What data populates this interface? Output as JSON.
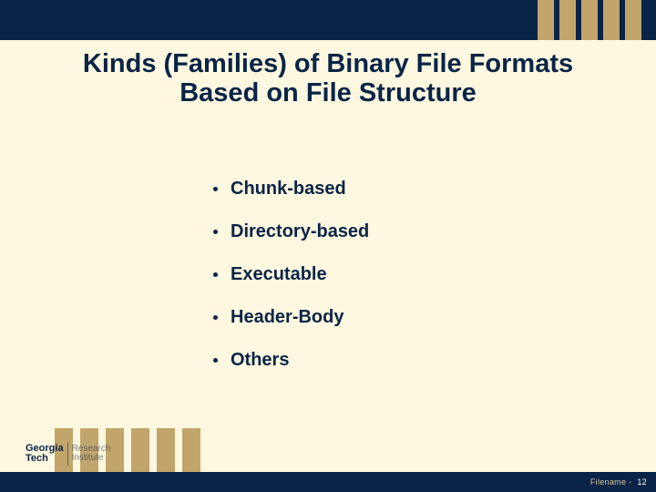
{
  "title_line1": "Kinds (Families) of Binary File Formats",
  "title_line2": "Based on File Structure",
  "bullets": {
    "b0": "Chunk-based",
    "b1": "Directory-based",
    "b2": "Executable",
    "b3": "Header-Body",
    "b4": "Others"
  },
  "logo": {
    "line1": "Georgia",
    "line2": "Tech",
    "ri1": "Research",
    "ri2": "Institute"
  },
  "footer": {
    "label": "Filename -",
    "page": "12"
  }
}
